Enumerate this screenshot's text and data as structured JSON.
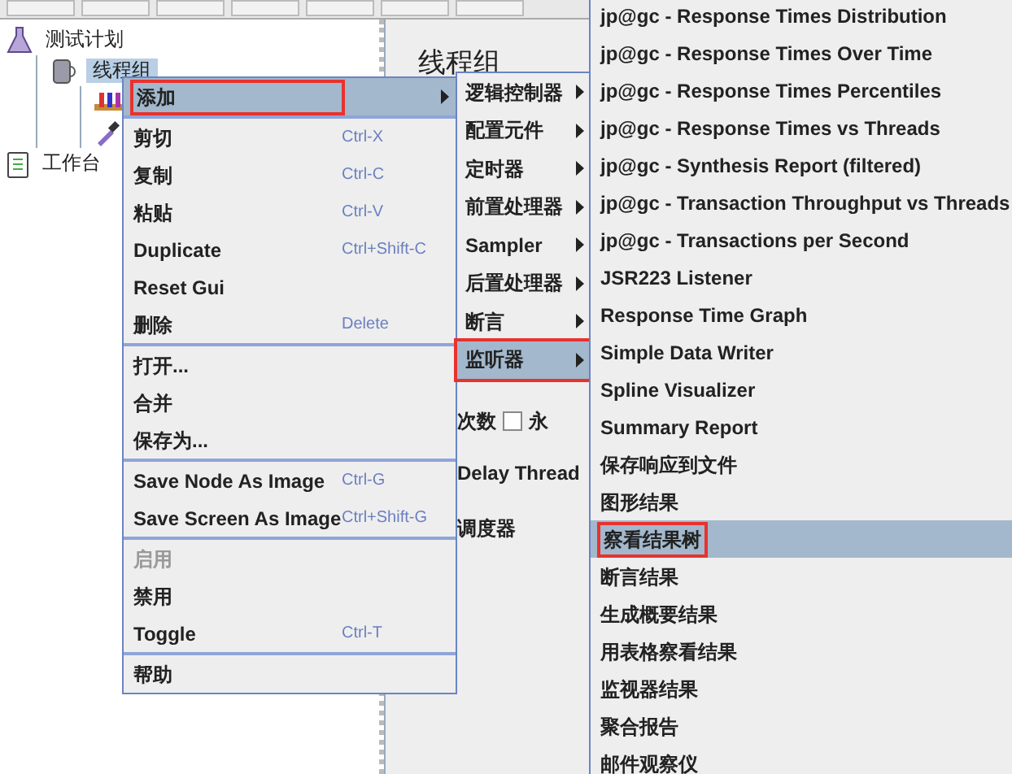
{
  "tree": [
    {
      "label": "测试计划",
      "kind": "plan",
      "selected": false,
      "children": [
        {
          "label": "线程组",
          "kind": "thread_group",
          "selected": true,
          "children": [
            {
              "kind": "sampler"
            },
            {
              "kind": "dropper"
            }
          ]
        }
      ]
    },
    {
      "label": "工作台",
      "kind": "workbench",
      "selected": false
    }
  ],
  "panel": {
    "title": "线程组",
    "loop_label": "次数",
    "forever": {
      "label": "永",
      "checked": false
    },
    "delay_label": "Delay Thread",
    "scheduler_label": "调度器"
  },
  "context_menu": {
    "groups": [
      [
        {
          "label": "添加",
          "submenu": true,
          "selected": true,
          "disabled": false
        }
      ],
      [
        {
          "label": "剪切",
          "shortcut": "Ctrl-X",
          "submenu": false,
          "selected": false,
          "disabled": false
        },
        {
          "label": "复制",
          "shortcut": "Ctrl-C",
          "submenu": false,
          "selected": false,
          "disabled": false
        },
        {
          "label": "粘贴",
          "shortcut": "Ctrl-V",
          "submenu": false,
          "selected": false,
          "disabled": false
        },
        {
          "label": "Duplicate",
          "shortcut": "Ctrl+Shift-C",
          "submenu": false,
          "selected": false,
          "disabled": false
        },
        {
          "label": "Reset Gui",
          "submenu": false,
          "selected": false,
          "disabled": false
        },
        {
          "label": "删除",
          "shortcut": "Delete",
          "submenu": false,
          "selected": false,
          "disabled": false
        }
      ],
      [
        {
          "label": "打开...",
          "submenu": false,
          "selected": false,
          "disabled": false
        },
        {
          "label": "合并",
          "submenu": false,
          "selected": false,
          "disabled": false
        },
        {
          "label": "保存为...",
          "submenu": false,
          "selected": false,
          "disabled": false
        }
      ],
      [
        {
          "label": "Save Node As Image",
          "shortcut": "Ctrl-G",
          "submenu": false,
          "selected": false,
          "disabled": false
        },
        {
          "label": "Save Screen As Image",
          "shortcut": "Ctrl+Shift-G",
          "submenu": false,
          "selected": false,
          "disabled": false
        }
      ],
      [
        {
          "label": "启用",
          "submenu": false,
          "selected": false,
          "disabled": true
        },
        {
          "label": "禁用",
          "submenu": false,
          "selected": false,
          "disabled": false
        },
        {
          "label": "Toggle",
          "shortcut": "Ctrl-T",
          "submenu": false,
          "selected": false,
          "disabled": false
        }
      ],
      [
        {
          "label": "帮助",
          "submenu": false,
          "selected": false,
          "disabled": false
        }
      ]
    ]
  },
  "add_submenu": [
    {
      "label": "逻辑控制器",
      "selected": false
    },
    {
      "label": "配置元件",
      "selected": false
    },
    {
      "label": "定时器",
      "selected": false
    },
    {
      "label": "前置处理器",
      "selected": false
    },
    {
      "label": "Sampler",
      "selected": false
    },
    {
      "label": "后置处理器",
      "selected": false
    },
    {
      "label": "断言",
      "selected": false
    },
    {
      "label": "监听器",
      "selected": true
    }
  ],
  "listener_submenu": [
    {
      "label": "jp@gc - Response Times Distribution",
      "selected": false
    },
    {
      "label": "jp@gc - Response Times Over Time",
      "selected": false
    },
    {
      "label": "jp@gc - Response Times Percentiles",
      "selected": false
    },
    {
      "label": "jp@gc - Response Times vs Threads",
      "selected": false
    },
    {
      "label": "jp@gc - Synthesis Report (filtered)",
      "selected": false
    },
    {
      "label": "jp@gc - Transaction Throughput vs Threads",
      "selected": false
    },
    {
      "label": "jp@gc - Transactions per Second",
      "selected": false
    },
    {
      "label": "JSR223 Listener",
      "selected": false
    },
    {
      "label": "Response Time Graph",
      "selected": false
    },
    {
      "label": "Simple Data Writer",
      "selected": false
    },
    {
      "label": "Spline Visualizer",
      "selected": false
    },
    {
      "label": "Summary Report",
      "selected": false
    },
    {
      "label": "保存响应到文件",
      "selected": false
    },
    {
      "label": "图形结果",
      "selected": false
    },
    {
      "label": "察看结果树",
      "selected": true
    },
    {
      "label": "断言结果",
      "selected": false
    },
    {
      "label": "生成概要结果",
      "selected": false
    },
    {
      "label": "用表格察看结果",
      "selected": false
    },
    {
      "label": "监视器结果",
      "selected": false
    },
    {
      "label": "聚合报告",
      "selected": false
    },
    {
      "label": "邮件观察仪",
      "selected": false
    }
  ]
}
